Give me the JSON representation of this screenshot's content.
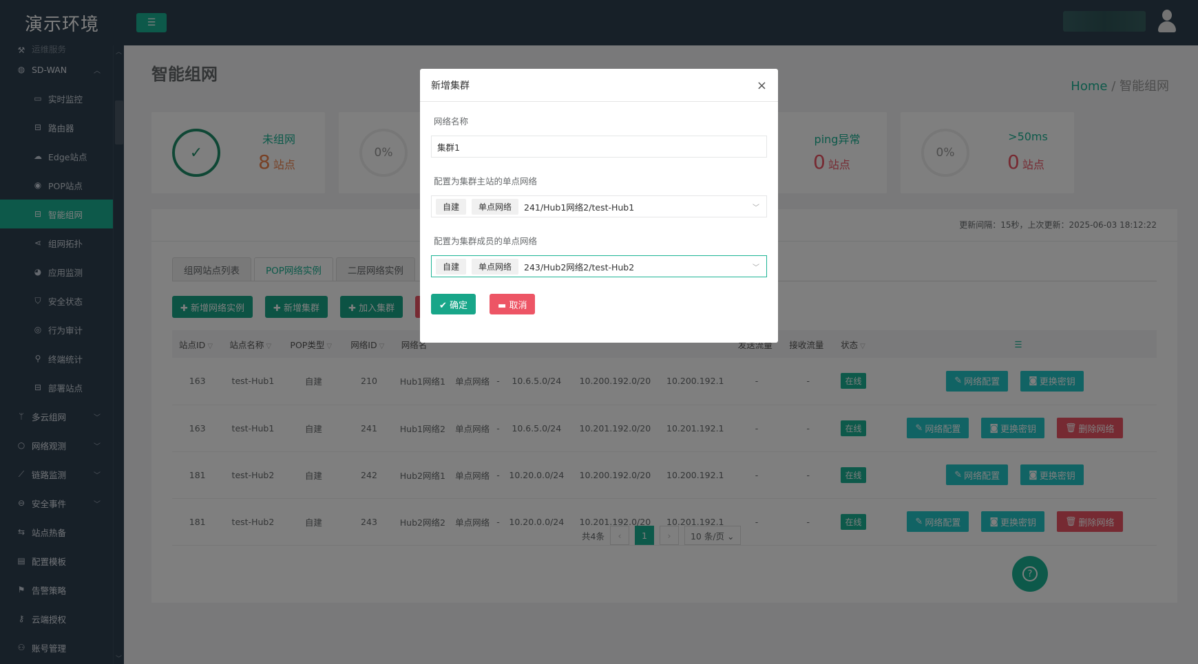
{
  "app": {
    "brand": "演示环境",
    "menu_toggle": "☰"
  },
  "sidebar": {
    "cut_item": "运维服务",
    "items": [
      {
        "label": "SD-WAN",
        "level": "top",
        "icon": "globe-icon",
        "glyph": "◍",
        "chev": "︿"
      },
      {
        "label": "实时监控",
        "level": "sub",
        "icon": "monitor-icon",
        "glyph": "▭"
      },
      {
        "label": "路由器",
        "level": "sub",
        "icon": "router-icon",
        "glyph": "⊟"
      },
      {
        "label": "Edge站点",
        "level": "sub",
        "icon": "cloud-icon",
        "glyph": "☁"
      },
      {
        "label": "POP站点",
        "level": "sub",
        "icon": "location-icon",
        "glyph": "◉"
      },
      {
        "label": "智能组网",
        "level": "sub",
        "icon": "lock-icon",
        "glyph": "⊟",
        "active": true
      },
      {
        "label": "组网拓扑",
        "level": "sub",
        "icon": "share-icon",
        "glyph": "⋖"
      },
      {
        "label": "应用监测",
        "level": "sub",
        "icon": "pie-chart-icon",
        "glyph": "◕"
      },
      {
        "label": "安全状态",
        "level": "sub",
        "icon": "shield-icon",
        "glyph": "⛉"
      },
      {
        "label": "行为审计",
        "level": "sub",
        "icon": "eye-icon",
        "glyph": "◎"
      },
      {
        "label": "终端统计",
        "level": "sub",
        "icon": "search-icon",
        "glyph": "⚲"
      },
      {
        "label": "部署站点",
        "level": "sub",
        "icon": "lock-icon",
        "glyph": "⊟"
      },
      {
        "label": "多云组网",
        "level": "top",
        "icon": "branch-icon",
        "glyph": "ᛘ",
        "chev": "﹀"
      },
      {
        "label": "网络观测",
        "level": "top",
        "icon": "circle-icon",
        "glyph": "○",
        "chev": "﹀"
      },
      {
        "label": "链路监测",
        "level": "top",
        "icon": "line-chart-icon",
        "glyph": "⟋",
        "chev": "﹀"
      },
      {
        "label": "安全事件",
        "level": "top",
        "icon": "minus-circle-icon",
        "glyph": "⊖",
        "chev": "﹀"
      },
      {
        "label": "站点热备",
        "level": "top",
        "icon": "exchange-icon",
        "glyph": "⇆"
      },
      {
        "label": "配置模板",
        "level": "top",
        "icon": "file-icon",
        "glyph": "▤"
      },
      {
        "label": "告警策略",
        "level": "top",
        "icon": "flag-icon",
        "glyph": "⚑"
      },
      {
        "label": "云端授权",
        "level": "top",
        "icon": "key-icon",
        "glyph": "⚷"
      },
      {
        "label": "账号管理",
        "level": "top",
        "icon": "users-icon",
        "glyph": "⚇"
      }
    ]
  },
  "page": {
    "title": "智能组网",
    "breadcrumb_home": "Home",
    "breadcrumb_sep": "/",
    "breadcrumb_current": "智能组网"
  },
  "stats": [
    {
      "label": "未组网",
      "value": "8",
      "unit": "站点",
      "circle": "✓"
    },
    {
      "label": "",
      "value": "",
      "unit": "",
      "circle": "0%"
    },
    {
      "label": "ping异常",
      "value": "0",
      "unit": "站点",
      "circle": "0%"
    },
    {
      "label": ">50ms",
      "value": "0",
      "unit": "站点",
      "circle": "0%"
    }
  ],
  "panel": {
    "update_info": "更新间隔：15秒，上次更新：2025-06-03 18:12:22",
    "tabs": [
      "组网站点列表",
      "POP网络实例",
      "二层网络实例"
    ],
    "buttons": [
      "✚ 新增网络实例",
      "✚ 新增集群",
      "✚ 加入集群"
    ],
    "columns": [
      "站点ID",
      "站点名称",
      "POP类型",
      "网络ID",
      "网络名",
      "",
      "",
      "",
      "",
      "",
      "发送流量",
      "接收流量",
      "状态",
      "☰"
    ],
    "rows": [
      {
        "site_id": "163",
        "site_name": "test-Hub1",
        "pop_type": "自建",
        "net_id": "210",
        "net_name": "Hub1网络1",
        "net_type": "单点网络",
        "c7": "-",
        "c8": "10.6.5.0/24",
        "c9": "10.200.192.0/20",
        "c10": "10.200.192.1",
        "tx": "-",
        "rx": "-",
        "status": "在线",
        "actions": [
          "网络配置",
          "更换密钥"
        ]
      },
      {
        "site_id": "163",
        "site_name": "test-Hub1",
        "pop_type": "自建",
        "net_id": "241",
        "net_name": "Hub1网络2",
        "net_type": "单点网络",
        "c7": "-",
        "c8": "10.6.5.0/24",
        "c9": "10.201.192.0/20",
        "c10": "10.201.192.1",
        "tx": "-",
        "rx": "-",
        "status": "在线",
        "actions": [
          "网络配置",
          "更换密钥",
          "删除网络"
        ]
      },
      {
        "site_id": "181",
        "site_name": "test-Hub2",
        "pop_type": "自建",
        "net_id": "242",
        "net_name": "Hub2网络1",
        "net_type": "单点网络",
        "c7": "-",
        "c8": "10.20.0.0/24",
        "c9": "10.200.192.0/20",
        "c10": "10.200.192.1",
        "tx": "-",
        "rx": "-",
        "status": "在线",
        "actions": [
          "网络配置",
          "更换密钥"
        ]
      },
      {
        "site_id": "181",
        "site_name": "test-Hub2",
        "pop_type": "自建",
        "net_id": "243",
        "net_name": "Hub2网络2",
        "net_type": "单点网络",
        "c7": "-",
        "c8": "10.20.0.0/24",
        "c9": "10.201.192.0/20",
        "c10": "10.201.192.1",
        "tx": "-",
        "rx": "-",
        "status": "在线",
        "actions": [
          "网络配置",
          "更换密钥",
          "删除网络"
        ]
      }
    ],
    "pager": {
      "total": "共4条",
      "prev": "‹",
      "page": "1",
      "next": "›",
      "size": "10 条/页 ⌄"
    }
  },
  "help": "?",
  "modal": {
    "title": "新增集群",
    "close": "×",
    "name_label": "网络名称",
    "name_value": "集群1",
    "master_label": "配置为集群主站的单点网络",
    "master": {
      "chip1": "自建",
      "chip2": "单点网络",
      "text": "241/Hub1网络2/test-Hub1"
    },
    "member_label": "配置为集群成员的单点网络",
    "member": {
      "chip1": "自建",
      "chip2": "单点网络",
      "text": "243/Hub2网络2/test-Hub2"
    },
    "confirm": "✔ 确定",
    "cancel": "▬ 取消"
  },
  "colors": {
    "accent": "#1ab394",
    "danger": "#ed5565",
    "sidebar": "#2f4050",
    "info": "#23c6c8"
  }
}
